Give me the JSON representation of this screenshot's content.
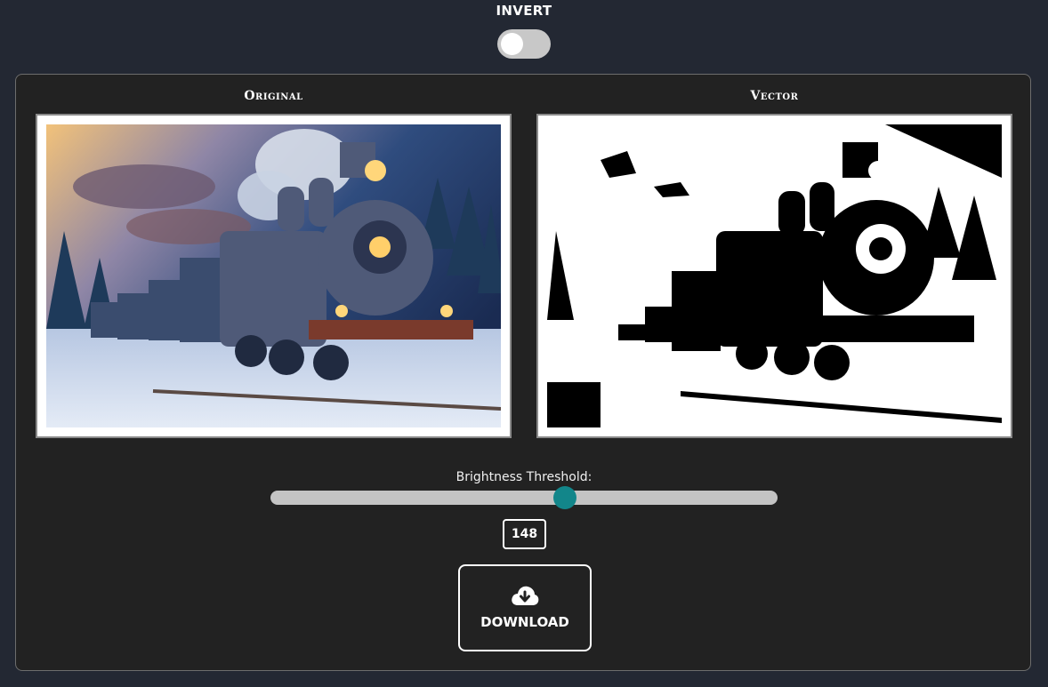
{
  "invert": {
    "label": "INVERT",
    "enabled": false
  },
  "images": {
    "original": {
      "title": "Original"
    },
    "vector": {
      "title": "Vector"
    }
  },
  "threshold": {
    "label": "Brightness Threshold:",
    "value": "148",
    "min": 0,
    "max": 255
  },
  "download": {
    "label": "DOWNLOAD",
    "icon": "cloud-download-icon"
  },
  "colors": {
    "accent": "#12868a",
    "background": "#232833",
    "panel": "#222222"
  }
}
